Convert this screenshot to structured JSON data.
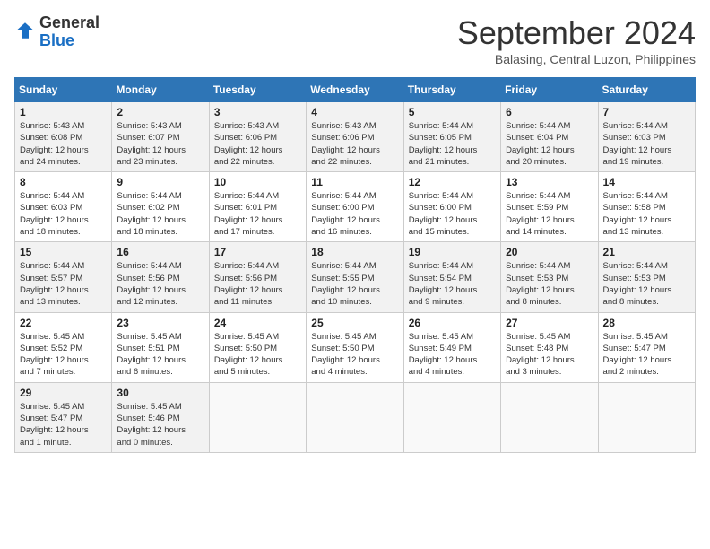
{
  "logo": {
    "general": "General",
    "blue": "Blue"
  },
  "title": "September 2024",
  "location": "Balasing, Central Luzon, Philippines",
  "weekdays": [
    "Sunday",
    "Monday",
    "Tuesday",
    "Wednesday",
    "Thursday",
    "Friday",
    "Saturday"
  ],
  "weeks": [
    [
      {
        "day": "1",
        "info": "Sunrise: 5:43 AM\nSunset: 6:08 PM\nDaylight: 12 hours\nand 24 minutes."
      },
      {
        "day": "2",
        "info": "Sunrise: 5:43 AM\nSunset: 6:07 PM\nDaylight: 12 hours\nand 23 minutes."
      },
      {
        "day": "3",
        "info": "Sunrise: 5:43 AM\nSunset: 6:06 PM\nDaylight: 12 hours\nand 22 minutes."
      },
      {
        "day": "4",
        "info": "Sunrise: 5:43 AM\nSunset: 6:06 PM\nDaylight: 12 hours\nand 22 minutes."
      },
      {
        "day": "5",
        "info": "Sunrise: 5:44 AM\nSunset: 6:05 PM\nDaylight: 12 hours\nand 21 minutes."
      },
      {
        "day": "6",
        "info": "Sunrise: 5:44 AM\nSunset: 6:04 PM\nDaylight: 12 hours\nand 20 minutes."
      },
      {
        "day": "7",
        "info": "Sunrise: 5:44 AM\nSunset: 6:03 PM\nDaylight: 12 hours\nand 19 minutes."
      }
    ],
    [
      {
        "day": "8",
        "info": "Sunrise: 5:44 AM\nSunset: 6:03 PM\nDaylight: 12 hours\nand 18 minutes."
      },
      {
        "day": "9",
        "info": "Sunrise: 5:44 AM\nSunset: 6:02 PM\nDaylight: 12 hours\nand 18 minutes."
      },
      {
        "day": "10",
        "info": "Sunrise: 5:44 AM\nSunset: 6:01 PM\nDaylight: 12 hours\nand 17 minutes."
      },
      {
        "day": "11",
        "info": "Sunrise: 5:44 AM\nSunset: 6:00 PM\nDaylight: 12 hours\nand 16 minutes."
      },
      {
        "day": "12",
        "info": "Sunrise: 5:44 AM\nSunset: 6:00 PM\nDaylight: 12 hours\nand 15 minutes."
      },
      {
        "day": "13",
        "info": "Sunrise: 5:44 AM\nSunset: 5:59 PM\nDaylight: 12 hours\nand 14 minutes."
      },
      {
        "day": "14",
        "info": "Sunrise: 5:44 AM\nSunset: 5:58 PM\nDaylight: 12 hours\nand 13 minutes."
      }
    ],
    [
      {
        "day": "15",
        "info": "Sunrise: 5:44 AM\nSunset: 5:57 PM\nDaylight: 12 hours\nand 13 minutes."
      },
      {
        "day": "16",
        "info": "Sunrise: 5:44 AM\nSunset: 5:56 PM\nDaylight: 12 hours\nand 12 minutes."
      },
      {
        "day": "17",
        "info": "Sunrise: 5:44 AM\nSunset: 5:56 PM\nDaylight: 12 hours\nand 11 minutes."
      },
      {
        "day": "18",
        "info": "Sunrise: 5:44 AM\nSunset: 5:55 PM\nDaylight: 12 hours\nand 10 minutes."
      },
      {
        "day": "19",
        "info": "Sunrise: 5:44 AM\nSunset: 5:54 PM\nDaylight: 12 hours\nand 9 minutes."
      },
      {
        "day": "20",
        "info": "Sunrise: 5:44 AM\nSunset: 5:53 PM\nDaylight: 12 hours\nand 8 minutes."
      },
      {
        "day": "21",
        "info": "Sunrise: 5:44 AM\nSunset: 5:53 PM\nDaylight: 12 hours\nand 8 minutes."
      }
    ],
    [
      {
        "day": "22",
        "info": "Sunrise: 5:45 AM\nSunset: 5:52 PM\nDaylight: 12 hours\nand 7 minutes."
      },
      {
        "day": "23",
        "info": "Sunrise: 5:45 AM\nSunset: 5:51 PM\nDaylight: 12 hours\nand 6 minutes."
      },
      {
        "day": "24",
        "info": "Sunrise: 5:45 AM\nSunset: 5:50 PM\nDaylight: 12 hours\nand 5 minutes."
      },
      {
        "day": "25",
        "info": "Sunrise: 5:45 AM\nSunset: 5:50 PM\nDaylight: 12 hours\nand 4 minutes."
      },
      {
        "day": "26",
        "info": "Sunrise: 5:45 AM\nSunset: 5:49 PM\nDaylight: 12 hours\nand 4 minutes."
      },
      {
        "day": "27",
        "info": "Sunrise: 5:45 AM\nSunset: 5:48 PM\nDaylight: 12 hours\nand 3 minutes."
      },
      {
        "day": "28",
        "info": "Sunrise: 5:45 AM\nSunset: 5:47 PM\nDaylight: 12 hours\nand 2 minutes."
      }
    ],
    [
      {
        "day": "29",
        "info": "Sunrise: 5:45 AM\nSunset: 5:47 PM\nDaylight: 12 hours\nand 1 minute."
      },
      {
        "day": "30",
        "info": "Sunrise: 5:45 AM\nSunset: 5:46 PM\nDaylight: 12 hours\nand 0 minutes."
      },
      {
        "day": "",
        "info": ""
      },
      {
        "day": "",
        "info": ""
      },
      {
        "day": "",
        "info": ""
      },
      {
        "day": "",
        "info": ""
      },
      {
        "day": "",
        "info": ""
      }
    ]
  ]
}
